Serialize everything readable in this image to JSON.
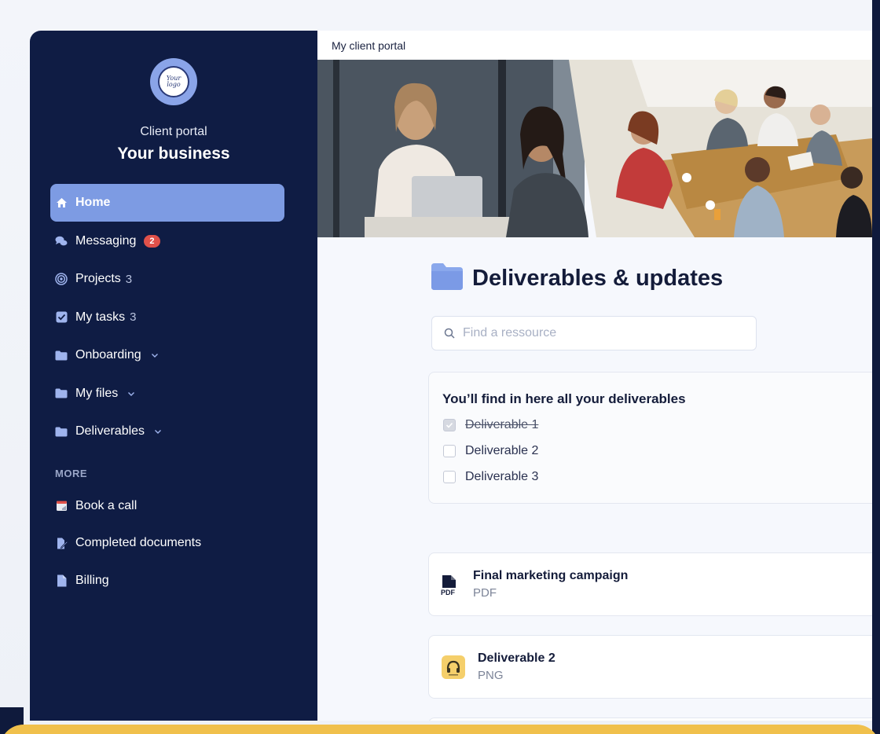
{
  "sidebar": {
    "portal_label": "Client portal",
    "business_name": "Your business",
    "logo_text": "Your logo",
    "nav": [
      {
        "label": "Home",
        "icon": "home-icon",
        "active": true
      },
      {
        "label": "Messaging",
        "icon": "chat-icon",
        "badge": "2"
      },
      {
        "label": "Projects",
        "icon": "target-icon",
        "count": "3"
      },
      {
        "label": "My tasks",
        "icon": "checkbox-icon",
        "count": "3"
      },
      {
        "label": "Onboarding",
        "icon": "folder-icon",
        "expandable": true
      },
      {
        "label": "My files",
        "icon": "folder-icon",
        "expandable": true
      },
      {
        "label": "Deliverables",
        "icon": "folder-icon",
        "expandable": true
      }
    ],
    "more_label": "MORE",
    "more": [
      {
        "label": "Book a call",
        "icon": "calendar-icon"
      },
      {
        "label": "Completed documents",
        "icon": "signed-document-icon"
      },
      {
        "label": "Billing",
        "icon": "document-icon"
      }
    ]
  },
  "main": {
    "topbar_title": "My client portal",
    "heading": "Deliverables & updates",
    "search_placeholder": "Find a ressource",
    "checklist": {
      "title": "You’ll find in here all your deliverables",
      "items": [
        {
          "label": "Deliverable 1",
          "checked": true
        },
        {
          "label": "Deliverable 2",
          "checked": false
        },
        {
          "label": "Deliverable 3",
          "checked": false
        }
      ]
    },
    "files": [
      {
        "name": "Final marketing campaign",
        "type": "PDF",
        "icon": "pdf-file-icon",
        "icon_text": "PDF"
      },
      {
        "name": "Deliverable 2",
        "type": "PNG",
        "icon": "image-thumbnail-icon"
      }
    ]
  },
  "colors": {
    "sidebar_bg": "#0f1c44",
    "accent": "#7d9be3",
    "badge": "#e0514a",
    "bottom_band": "#f0c04c"
  }
}
